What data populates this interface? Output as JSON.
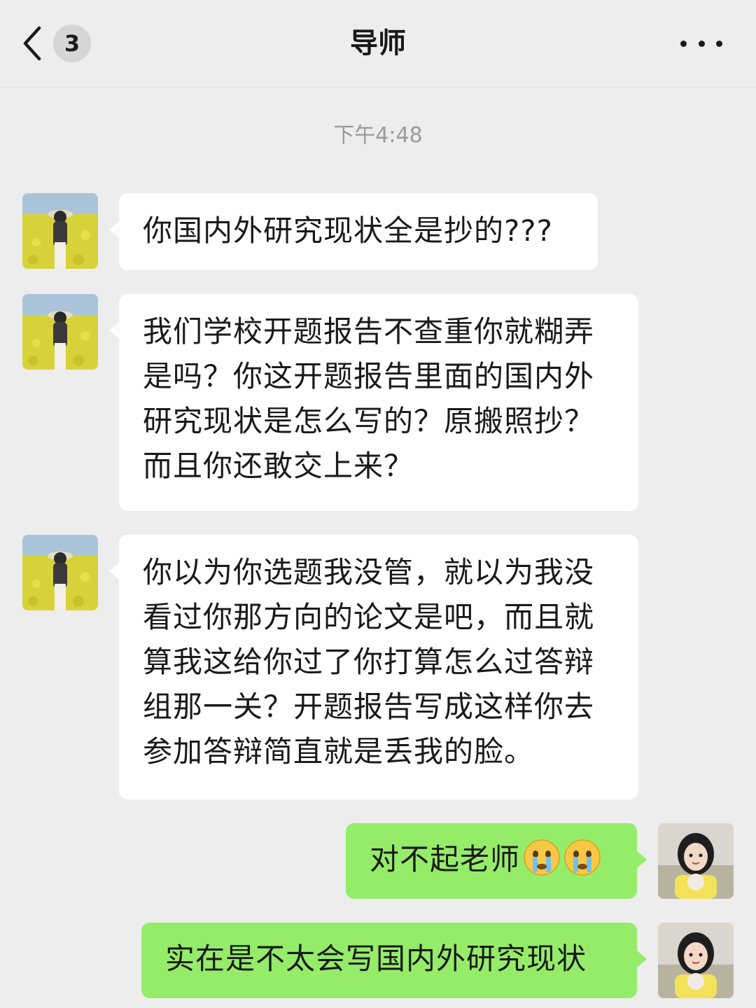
{
  "header": {
    "back_icon": "chevron-left-icon",
    "unread_count": "3",
    "title": "导师",
    "more_icon": "more-dots-icon"
  },
  "timestamp": "下午4:48",
  "messages": [
    {
      "sender": "导师",
      "side": "left",
      "text": "你国内外研究现状全是抄的???"
    },
    {
      "sender": "导师",
      "side": "left",
      "text": "我们学校开题报告不查重你就糊弄是吗？你这开题报告里面的国内外研究现状是怎么写的？原搬照抄？而且你还敢交上来？"
    },
    {
      "sender": "导师",
      "side": "left",
      "text": "你以为你选题我没管，就以为我没看过你那方向的论文是吧，而且就算我这给你过了你打算怎么过答辩组那一关？开题报告写成这样你去参加答辩简直就是丢我的脸。"
    },
    {
      "sender": "me",
      "side": "right",
      "text": "对不起老师",
      "emojis": [
        "crying-face-emoji",
        "crying-face-emoji"
      ]
    },
    {
      "sender": "me",
      "side": "right",
      "text": "实在是不太会写国内外研究现状"
    }
  ],
  "colors": {
    "background": "#ededed",
    "incoming_bubble": "#ffffff",
    "outgoing_bubble": "#95ec69",
    "timestamp_text": "#9a9a9a"
  }
}
